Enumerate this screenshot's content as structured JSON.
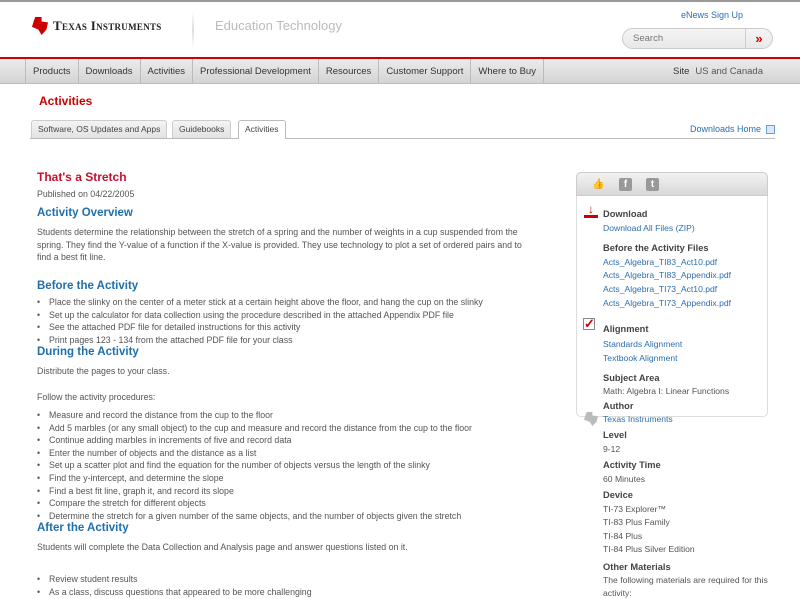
{
  "header": {
    "brand": "Texas Instruments",
    "section": "Education Technology",
    "enews": "eNews Sign Up",
    "search_placeholder": "Search",
    "search_go": "»"
  },
  "nav": {
    "items": [
      "Products",
      "Downloads",
      "Activities",
      "Professional Development",
      "Resources",
      "Customer Support",
      "Where to Buy"
    ],
    "site_label": "Site",
    "site_value": "US and Canada"
  },
  "page_title": "Activities",
  "tabs": [
    "Software, OS Updates and Apps",
    "Guidebooks",
    "Activities"
  ],
  "downloads_home": "Downloads Home",
  "main": {
    "title": "That's a Stretch",
    "published": "Published on 04/22/2005",
    "overview_heading": "Activity Overview",
    "overview": "Students determine the relationship between the stretch of a spring and the number of weights in a cup suspended from the spring. They find the Y-value of a function if the X-value is provided. They use technology to plot a set of ordered pairs and to find a best fit line.",
    "before_heading": "Before the Activity",
    "before_items": [
      "Place the slinky on the center of a meter stick at a certain height above the floor, and hang the cup on the slinky",
      "Set up the calculator for data collection using the procedure described in the attached Appendix PDF file",
      "See the attached PDF file for detailed instructions for this activity",
      "Print pages 123 - 134 from the attached PDF file for your class"
    ],
    "during_heading": "During the Activity",
    "during_intro": "Distribute the pages to your class.",
    "during_follow": "Follow the activity procedures:",
    "during_items": [
      "Measure and record the distance from the cup to the floor",
      "Add 5 marbles (or any small object) to the cup and measure and record the distance from the cup to the floor",
      "Continue adding marbles in increments of five and record data",
      "Enter the number of objects and the distance as a list",
      "Set up a scatter plot and find the equation for the number of objects versus the length of the slinky",
      "Find the y-intercept, and determine the slope",
      "Find a best fit line, graph it, and record its slope",
      "Compare the stretch for different objects",
      "Determine the stretch for a given number of the same objects, and the number of objects given the stretch"
    ],
    "after_heading": "After the Activity",
    "after_intro": "Students will complete the Data Collection and Analysis page and answer questions listed on it.",
    "after_items": [
      "Review student results",
      "As a class, discuss questions that appeared to be more challenging"
    ]
  },
  "sidebar": {
    "download_heading": "Download",
    "download_all": "Download All Files (ZIP)",
    "before_files_heading": "Before the Activity Files",
    "files": [
      "Acts_Algebra_TI83_Act10.pdf",
      "Acts_Algebra_TI83_Appendix.pdf",
      "Acts_Algebra_TI73_Act10.pdf",
      "Acts_Algebra_TI73_Appendix.pdf"
    ],
    "alignment_heading": "Alignment",
    "alignment_links": [
      "Standards Alignment",
      "Textbook Alignment"
    ],
    "subject_heading": "Subject Area",
    "subject": "Math: Algebra I: Linear Functions",
    "author_heading": "Author",
    "author": "Texas Instruments",
    "level_heading": "Level",
    "level": "9-12",
    "time_heading": "Activity Time",
    "time": "60 Minutes",
    "device_heading": "Device",
    "devices": [
      "TI-73 Explorer™",
      "TI-83 Plus Family",
      "TI-84 Plus",
      "TI-84 Plus Silver Edition"
    ],
    "materials_heading": "Other Materials",
    "materials": "The following materials are required for this activity:"
  }
}
